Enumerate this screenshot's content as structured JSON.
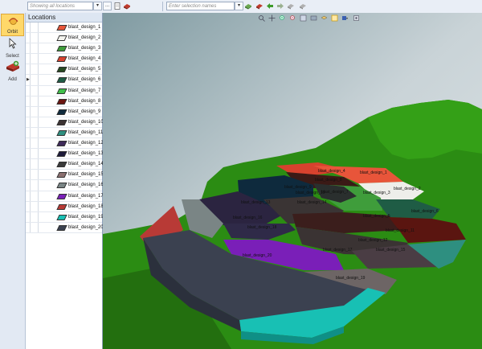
{
  "toolbar": {
    "locations_combo": "Showing all locations",
    "ellipsis_label": "...",
    "selection_combo_placeholder": "Enter selection names"
  },
  "tools": [
    {
      "label": "Orbit",
      "icon": "orbit-icon",
      "active": true
    },
    {
      "label": "Select",
      "icon": "cursor-icon",
      "active": false
    },
    {
      "label": "Add",
      "icon": "add-block-icon",
      "active": false
    }
  ],
  "locations": {
    "header": "Locations",
    "items": [
      {
        "name": "blast_design_1",
        "color": "#e8553a"
      },
      {
        "name": "blast_design_2",
        "color": "#f3f3ee"
      },
      {
        "name": "blast_design_3",
        "color": "#3f9d3b"
      },
      {
        "name": "blast_design_4",
        "color": "#d7422e"
      },
      {
        "name": "blast_design_5",
        "color": "#274a22"
      },
      {
        "name": "blast_design_6",
        "color": "#1f5c45"
      },
      {
        "name": "blast_design_7",
        "color": "#3fbf4a"
      },
      {
        "name": "blast_design_8",
        "color": "#6b1510"
      },
      {
        "name": "blast_design_9",
        "color": "#0e2a3d"
      },
      {
        "name": "blast_design_10",
        "color": "#3b3232"
      },
      {
        "name": "blast_design_11",
        "color": "#2e8f80"
      },
      {
        "name": "blast_design_12",
        "color": "#3e2a5a"
      },
      {
        "name": "blast_design_13",
        "color": "#1d1a3a"
      },
      {
        "name": "blast_design_14",
        "color": "#3a3a3a"
      },
      {
        "name": "blast_design_15",
        "color": "#8b7070"
      },
      {
        "name": "blast_design_16",
        "color": "#7a8585"
      },
      {
        "name": "blast_design_17",
        "color": "#7a1fb8"
      },
      {
        "name": "blast_design_18",
        "color": "#b83a36"
      },
      {
        "name": "blast_design_19",
        "color": "#18c0b4"
      },
      {
        "name": "blast_design_20",
        "color": "#3b4150"
      }
    ]
  },
  "scene_labels": [
    "blast_design_4",
    "blast_design_1",
    "blast_design_8",
    "blast_design_2",
    "blast_design_9",
    "blast_design_3",
    "blast_design_7",
    "blast_design_10",
    "blast_design_13",
    "blast_design_14",
    "blast_design_6",
    "blast_design_16",
    "blast_design_5",
    "blast_design_18",
    "blast_design_11",
    "blast_design_12",
    "blast_design_15",
    "blast_design_17",
    "blast_design_20",
    "blast_design_19"
  ],
  "colors": {
    "terrain": "#2a8a14",
    "terrain_dark": "#216e10",
    "sky": "#c7d2d6"
  }
}
